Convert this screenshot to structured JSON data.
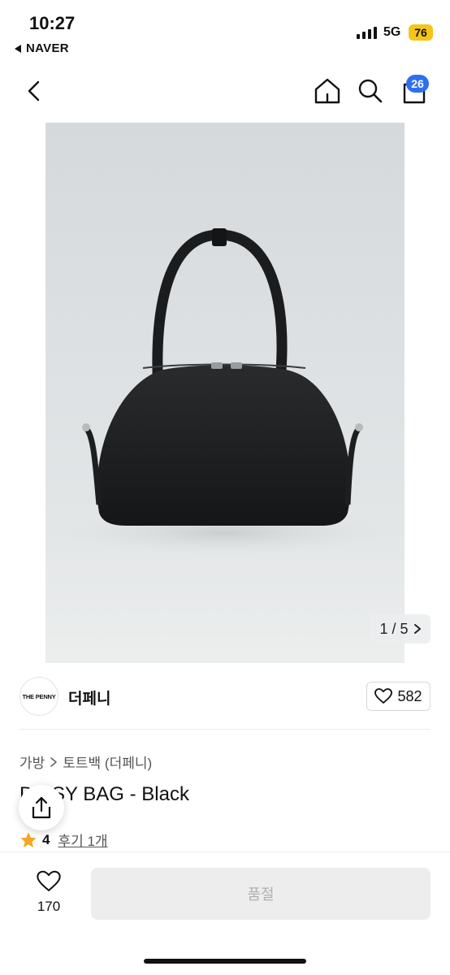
{
  "status_bar": {
    "time": "10:27",
    "back_app": "NAVER",
    "network": "5G",
    "battery": "76"
  },
  "nav": {
    "cart_count": "26",
    "icons": [
      "back-chevron-icon",
      "home-icon",
      "search-icon",
      "cart-icon"
    ]
  },
  "gallery": {
    "current": "1",
    "total": "5",
    "pager_text": "1 / 5"
  },
  "brand": {
    "logo_text": "THE PENNY",
    "name": "더페니",
    "likes": "582"
  },
  "product": {
    "breadcrumb": [
      "가방",
      "토트백 (더페니)"
    ],
    "title": "DAISY BAG - Black",
    "rating": "4",
    "reviews": "후기 1개"
  },
  "bottom_bar": {
    "wish_count": "170",
    "buy_label": "품절"
  },
  "colors": {
    "accent": "#2f6ff2",
    "battery": "#f5c518",
    "star": "#f5a623"
  }
}
